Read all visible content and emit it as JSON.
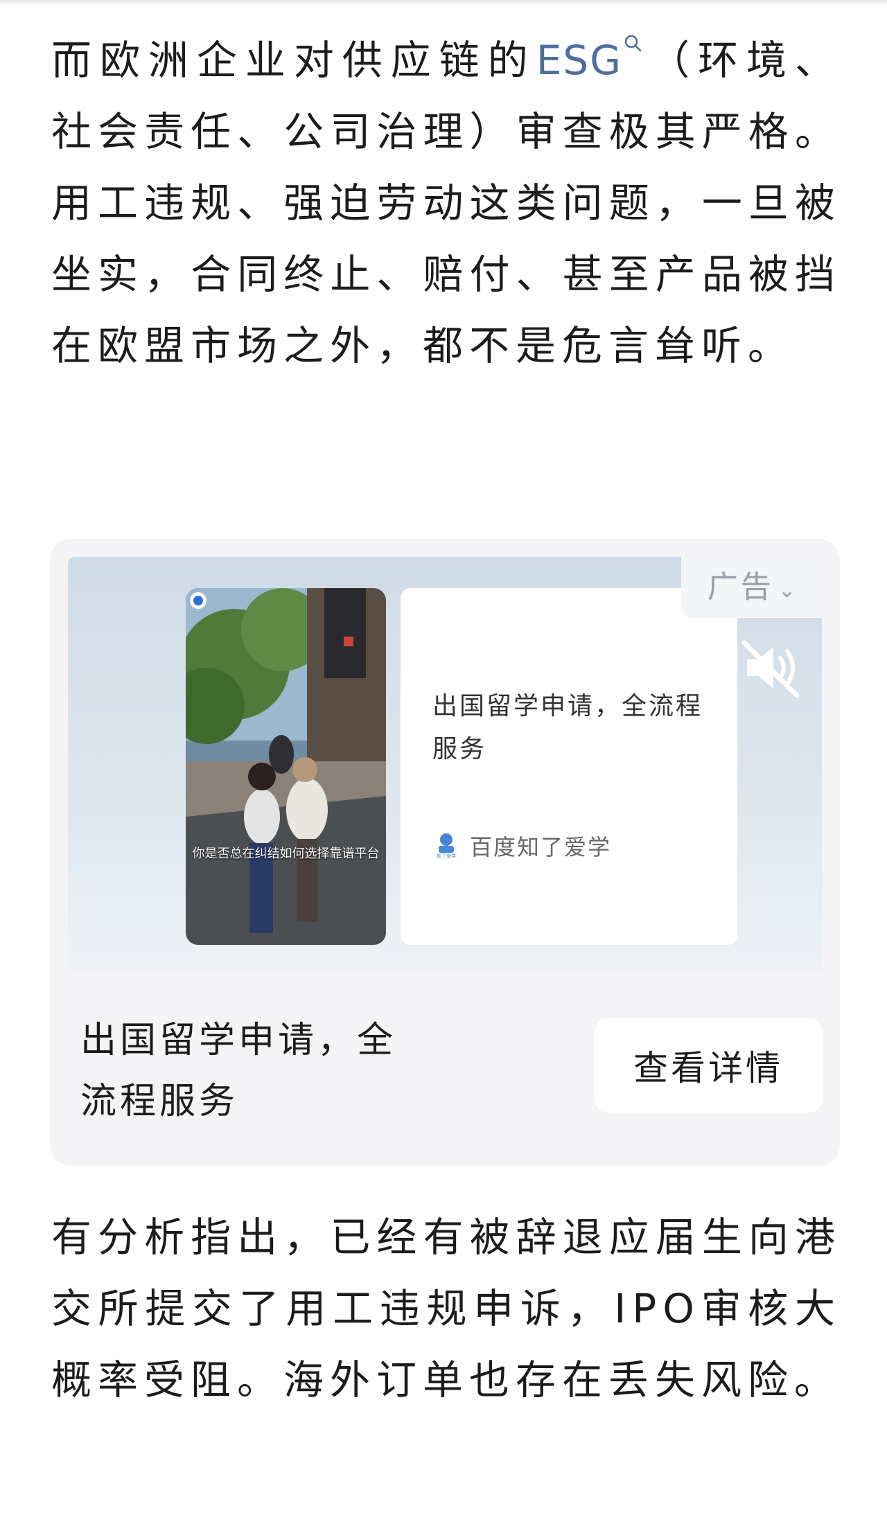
{
  "article": {
    "para1_before": "而欧洲企业对供应链的",
    "para1_keyword": "ESG",
    "para1_after": "（环境、社会责任、公司治理）审查极其严格。用工违规、强迫劳动这类问题，一旦被坐实，合同终止、赔付、甚至产品被挡在欧盟市场之外，都不是危言耸听。",
    "para2": "有分析指出，已经有被辞退应届生向港交所提交了用工违规申诉，IPO审核大概率受阻。海外订单也存在丢失风险。"
  },
  "ad": {
    "badge_label": "广告",
    "video_caption": "你是否总在纠结如何选择靠谱平台",
    "info_title": "出国留学申请，全流程服务",
    "brand_name": "百度知了爱学",
    "brand_logo_text": "知了爱学",
    "headline": "出国留学申请，全流程服务",
    "cta_label": "查看详情"
  },
  "colors": {
    "keyword_link": "#4e6ea0",
    "ad_card_bg": "#f4f4f6",
    "body_text": "#1c1c1c"
  }
}
